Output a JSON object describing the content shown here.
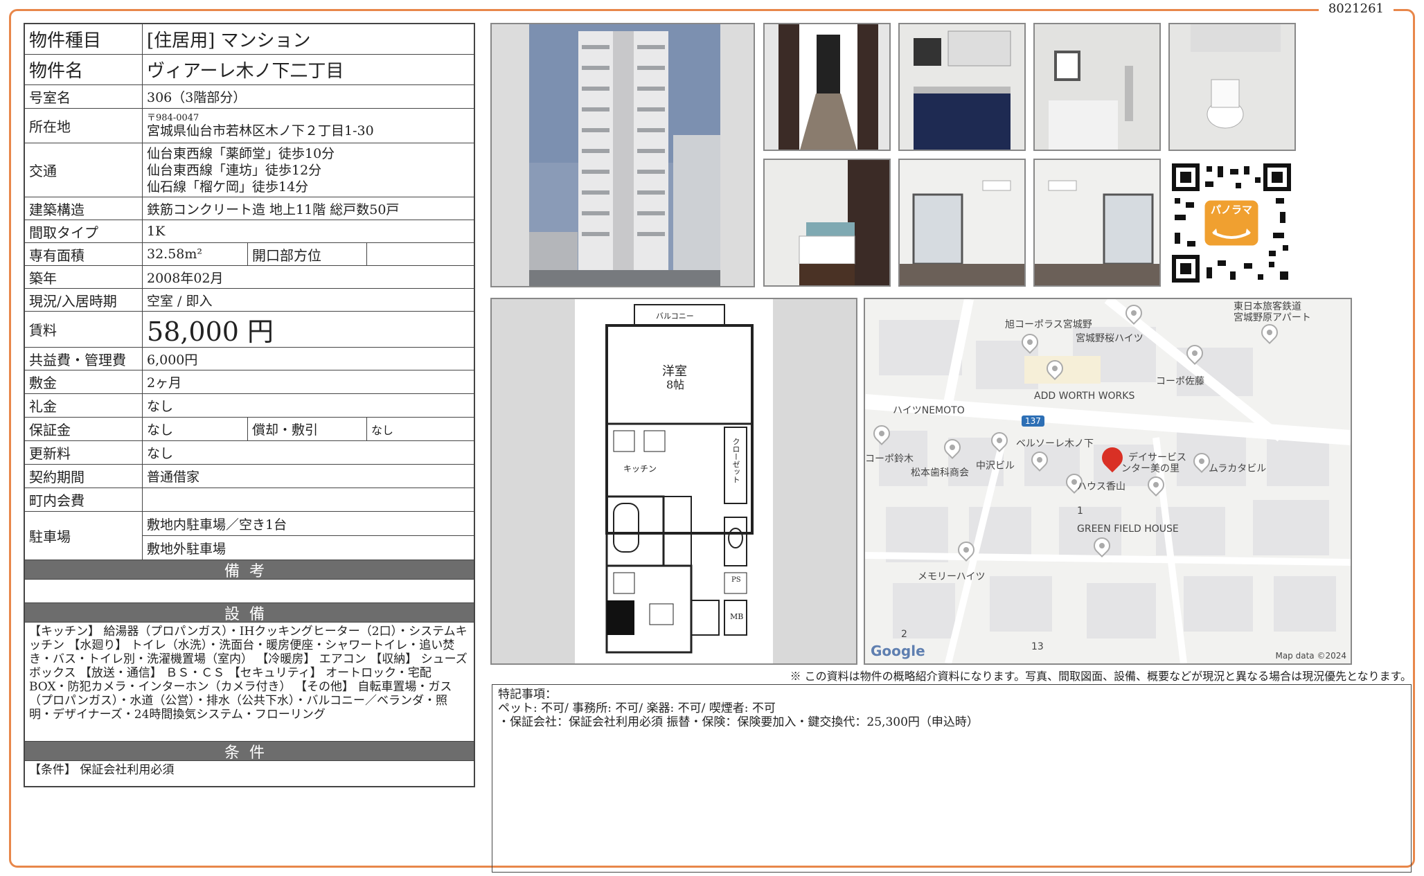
{
  "doc_id": "8021261",
  "property": {
    "type_label": "物件種目",
    "type_value": "[住居用] マンション",
    "name_label": "物件名",
    "name_value": "ヴィアーレ木ノ下二丁目",
    "room_label": "号室名",
    "room_value": "306（3階部分）",
    "address_label": "所在地",
    "postal": "〒984-0047",
    "address": "宮城県仙台市若林区木ノ下２丁目1-30",
    "transport_label": "交通",
    "transport": [
      "仙台東西線「薬師堂」徒歩10分",
      "仙台東西線「連坊」徒歩12分",
      "仙石線「榴ケ岡」徒歩14分"
    ],
    "structure_label": "建築構造",
    "structure_value": "鉄筋コンクリート造 地上11階 総戸数50戸",
    "layout_label": "間取タイプ",
    "layout_value": "1K",
    "area_label": "専有面積",
    "area_value": "32.58m²",
    "direction_label": "開口部方位",
    "direction_value": "",
    "built_label": "築年",
    "built_value": "2008年02月",
    "status_label": "現況/入居時期",
    "status_value": "空室 / 即入",
    "rent_label": "賃料",
    "rent_value": "58,000 円",
    "fee_label": "共益費・管理費",
    "fee_value": "6,000円",
    "deposit_label": "敷金",
    "deposit_value": "2ヶ月",
    "keymoney_label": "礼金",
    "keymoney_value": "なし",
    "guarantee_label": "保証金",
    "guarantee_value": "なし",
    "amort_label": "償却・敷引",
    "amort_value": "なし",
    "renewal_label": "更新料",
    "renewal_value": "なし",
    "contract_label": "契約期間",
    "contract_value": "普通借家",
    "town_label": "町内会費",
    "town_value": "",
    "parking_label": "駐車場",
    "parking_on": "敷地内駐車場／空き1台",
    "parking_off": "敷地外駐車場"
  },
  "bands": {
    "remarks": "備考",
    "equipment": "設備",
    "conditions": "条件"
  },
  "equipment_text": "【キッチン】 給湯器（プロパンガス）・IHクッキングヒーター（2口）・システムキッチン 【水廻り】 トイレ（水洗）・洗面台・暖房便座・シャワートイレ・追い焚き・バス・トイレ別・洗濯機置場（室内） 【冷暖房】 エアコン 【収納】 シューズボックス 【放送・通信】 ＢＳ・ＣＳ 【セキュリティ】 オートロック・宅配BOX・防犯カメラ・インターホン（カメラ付き） 【その他】 自転車置場・ガス（プロパンガス）・水道（公営）・排水（公共下水）・バルコニー／ベランダ・照明・デザイナーズ・24時間換気システム・フローリング",
  "conditions_text": "【条件】 保証会社利用必須",
  "floorplan": {
    "balcony": "バルコニー",
    "room": "洋室",
    "room_size": "8帖",
    "kitchen": "キッチン",
    "closet": "クローゼット",
    "ps": "PS",
    "mb": "MB"
  },
  "qr": {
    "badge": "パノラマ"
  },
  "map": {
    "labels": [
      "旭コーポラス宮城野",
      "宮城野桜ハイツ",
      "東日本旅客鉄道",
      "宮城野原アパート",
      "コーポ佐藤",
      "ADD WORTH WORKS",
      "ハイツNEMOTO",
      "137",
      "ベルソーレ木ノ下",
      "デイサービス",
      "ンター美の里",
      "ムラカタビル",
      "コーポ鈴木",
      "松本歯科商会",
      "中沢ビル",
      "ハウス香山",
      "1",
      "GREEN FIELD HOUSE",
      "メモリーハイツ",
      "2",
      "13"
    ],
    "google": "Google",
    "credit": "Map data ©2024"
  },
  "disclaimer": "※ この資料は物件の概略紹介資料になります。写真、間取図面、設備、概要などが現況と異なる場合は現況優先となります。",
  "special": {
    "title": "特記事項：",
    "line1": "ペット: 不可/ 事務所: 不可/ 楽器: 不可/ 喫煙者: 不可",
    "line2": "・保証会社：保証会社利用必須 振替・保険：保険要加入・鍵交換代：25,300円（申込時）"
  }
}
